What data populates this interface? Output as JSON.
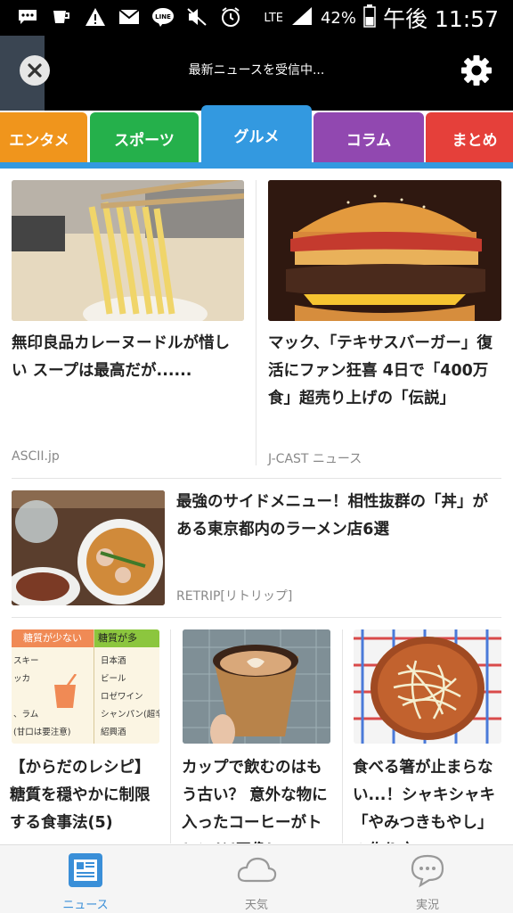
{
  "status_bar": {
    "network": "LTE",
    "battery": "42%",
    "time": "午後 11:57",
    "icons": [
      "sms-icon",
      "cup-icon",
      "warning-icon",
      "mail-icon",
      "line-icon",
      "mute-icon",
      "alarm-icon",
      "signal-icon",
      "battery-icon"
    ]
  },
  "header": {
    "status_text": "最新ニュースを受信中..."
  },
  "tabs": [
    {
      "label": "エンタメ",
      "color": "#f0951c"
    },
    {
      "label": "スポーツ",
      "color": "#25b04b"
    },
    {
      "label": "グルメ",
      "color": "#3399e0",
      "active": true
    },
    {
      "label": "コラム",
      "color": "#9148b0"
    },
    {
      "label": "まとめ",
      "color": "#e5403a"
    }
  ],
  "articles": [
    {
      "title": "無印良品カレーヌードルが惜しい スープは最高だが......",
      "source": "ASCII.jp"
    },
    {
      "title": "マック、「テキサスバーガー」復活にファン狂喜 4日で「400万食」超売り上げの「伝説」",
      "source": "J-CAST ニュース"
    },
    {
      "title": "最強のサイドメニュー！相性抜群の「丼」がある東京都内のラーメン店6選",
      "source": "RETRIP[リトリップ]"
    },
    {
      "title": "【からだのレシピ】糖質を穏やかに制限する食事法(5)",
      "source": ""
    },
    {
      "title": "カップで飲むのはもう古い？ 意外な物に入ったコーヒーがトレンド(画像)",
      "source": ""
    },
    {
      "title": "食べる箸が止まらない...！シャキシャキ「やみつきもやし」の作り方",
      "source": ""
    }
  ],
  "recipe_thumb": {
    "left_header": "糖質が少ない",
    "right_header": "糖質が多",
    "left_items": [
      "スキー",
      "ッカ",
      "",
      "、ラム",
      "(甘口は要注意)"
    ],
    "right_items": [
      "日本酒",
      "ビール",
      "ロゼワイン",
      "シャンパン(超辛",
      "紹興酒"
    ]
  },
  "bottom_nav": [
    {
      "label": "ニュース",
      "active": true
    },
    {
      "label": "天気"
    },
    {
      "label": "実況"
    }
  ],
  "colors": {
    "accent": "#3399e0",
    "header_bg": "#000000"
  }
}
